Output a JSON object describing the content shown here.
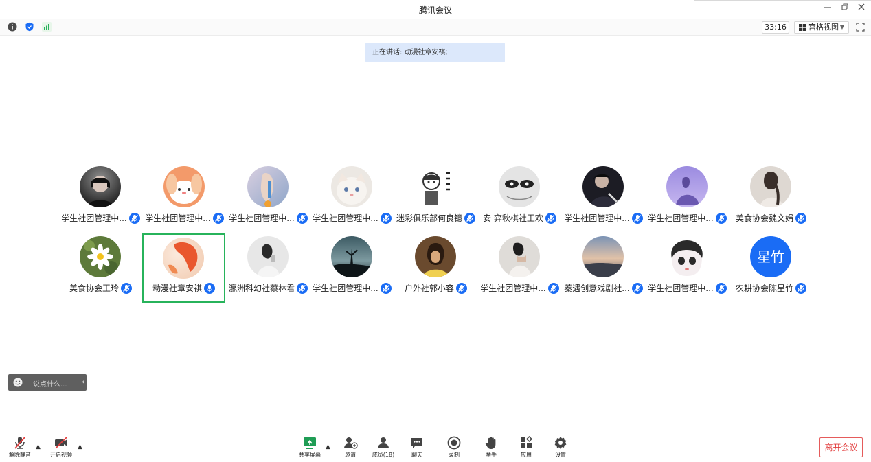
{
  "window": {
    "title": "腾讯会议"
  },
  "toolbar": {
    "timer": "33:16",
    "view_label": "宫格视图"
  },
  "speaking": {
    "text": "正在讲话: 动漫社章安祺;"
  },
  "participants": [
    {
      "name": "学生社团管理中..."
    },
    {
      "name": "学生社团管理中..."
    },
    {
      "name": "学生社团管理中..."
    },
    {
      "name": "学生社团管理中..."
    },
    {
      "name": "迷彩俱乐部何良镱"
    },
    {
      "name": "安  弈秋棋社王欢"
    },
    {
      "name": "学生社团管理中..."
    },
    {
      "name": "学生社团管理中..."
    },
    {
      "name": "美食协会魏文娟"
    },
    {
      "name": "美食协会王玲"
    },
    {
      "name": "动漫社章安祺"
    },
    {
      "name": "瀛洲科幻社蔡林君"
    },
    {
      "name": "学生社团管理中..."
    },
    {
      "name": "户外社郭小容"
    },
    {
      "name": "学生社团管理中..."
    },
    {
      "name": "蓁遇创意戏剧社..."
    },
    {
      "name": "学生社团管理中..."
    },
    {
      "name": "农耕协会陈星竹",
      "avatar_text": "星竹"
    }
  ],
  "chat": {
    "placeholder": "说点什么..."
  },
  "bottom": {
    "unmute": "解除静音",
    "video": "开启视频",
    "share": "共享屏幕",
    "invite": "邀请",
    "members": "成员(18)",
    "chat": "聊天",
    "record": "录制",
    "raise_hand": "举手",
    "apps": "应用",
    "settings": "设置",
    "leave": "离开会议"
  },
  "colors": {
    "accent": "#1a6cf5",
    "active_border": "#27b35b",
    "leave": "#e23c3c",
    "speaking_bg": "#dce8fb"
  }
}
